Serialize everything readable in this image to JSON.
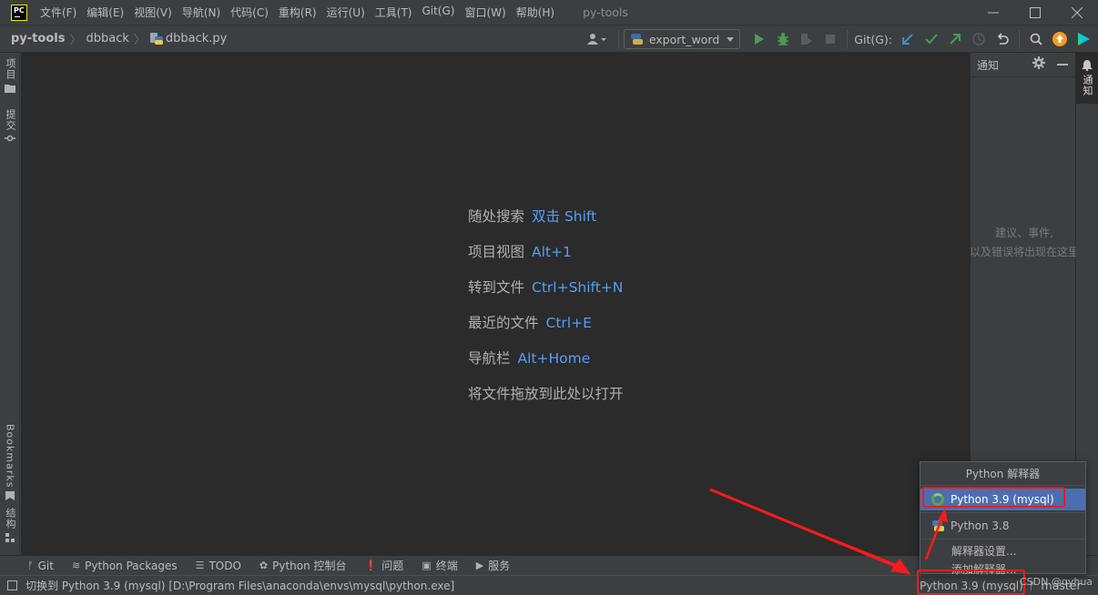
{
  "app": {
    "logo": "PC",
    "window_title": "py-tools",
    "menu": [
      "文件(F)",
      "编辑(E)",
      "视图(V)",
      "导航(N)",
      "代码(C)",
      "重构(R)",
      "运行(U)",
      "工具(T)",
      "Git(G)",
      "窗口(W)",
      "帮助(H)"
    ]
  },
  "breadcrumb": [
    "py-tools",
    "dbback",
    "dbback.py"
  ],
  "toolbar": {
    "run_config": "export_word",
    "git_label": "Git(G):",
    "icons": [
      "user-icon",
      "run-icon",
      "debug-icon",
      "coverage-icon",
      "stop-icon",
      "git-update-icon",
      "git-commit-icon",
      "git-push-icon",
      "history-icon",
      "rollback-icon",
      "search-icon",
      "update-icon",
      "jetbrains-toolbox-icon"
    ],
    "colors": {
      "run": "#499c54",
      "git_update": "#3592c4",
      "git_commit": "#499c54",
      "update_badge": "#f59b23"
    }
  },
  "left_tabs": [
    {
      "label": "项目",
      "icon": "folder-icon"
    },
    {
      "label": "提交",
      "icon": "commit-icon"
    },
    {
      "label": "Bookmarks",
      "icon": "bookmark-icon"
    },
    {
      "label": "结构",
      "icon": "structure-icon"
    }
  ],
  "editor": {
    "hints": [
      {
        "label": "随处搜索",
        "key": "双击 Shift"
      },
      {
        "label": "项目视图",
        "key": "Alt+1"
      },
      {
        "label": "转到文件",
        "key": "Ctrl+Shift+N"
      },
      {
        "label": "最近的文件",
        "key": "Ctrl+E"
      },
      {
        "label": "导航栏",
        "key": "Alt+Home"
      },
      {
        "label": "将文件拖放到此处以打开",
        "key": ""
      }
    ],
    "key_color": "#589df6"
  },
  "notifications": {
    "title": "通知",
    "empty_line1": "建议、事件,",
    "empty_line2": "以及错误将出现在这里",
    "right_tab": "通知"
  },
  "bottom_tabs": [
    {
      "label": "Git",
      "icon": "git-branch-icon"
    },
    {
      "label": "Python Packages",
      "icon": "packages-icon"
    },
    {
      "label": "TODO",
      "icon": "todo-icon"
    },
    {
      "label": "Python 控制台",
      "icon": "python-console-icon"
    },
    {
      "label": "问题",
      "icon": "problems-icon"
    },
    {
      "label": "终端",
      "icon": "terminal-icon"
    },
    {
      "label": "服务",
      "icon": "services-icon"
    }
  ],
  "status": {
    "message": "切换到 Python 3.9 (mysql) [D:\\Program Files\\anaconda\\envs\\mysql\\python.exe]",
    "interpreter": "Python 3.9 (mysql)",
    "branch": "master"
  },
  "popup": {
    "title": "Python 解释器",
    "items": [
      {
        "label": "Python 3.9 (mysql)",
        "selected": true,
        "icon": "conda-ring-icon"
      },
      {
        "label": "Python 3.8",
        "selected": false,
        "icon": "python-icon"
      }
    ],
    "actions": [
      "解释器设置...",
      "添加解释器..."
    ]
  },
  "watermark": "CSDN @qyhua",
  "annotation_color": "#ff1a1a"
}
